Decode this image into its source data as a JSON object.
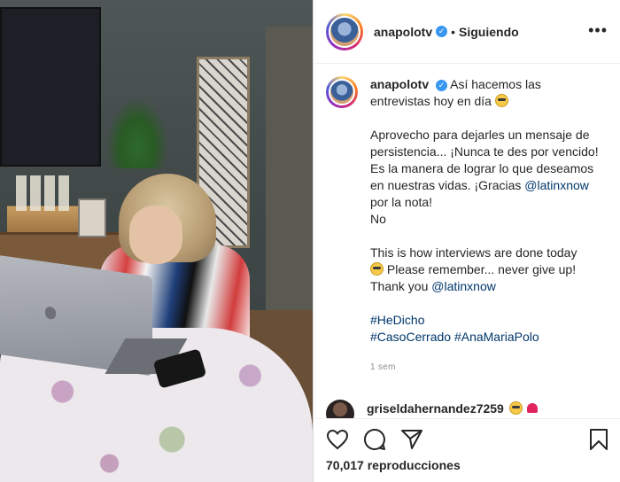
{
  "post": {
    "username": "anapolotv",
    "follow_status": "Siguiendo",
    "more_label": "•••"
  },
  "caption": {
    "username": "anapolotv",
    "line1": "Así hacemos las entrevistas hoy en día",
    "para2_pre": "Aprovecho para dejarles un mensaje de persistencia... ¡Nunca te des por vencido! Es la manera de lograr lo que deseamos en nuestras vidas. ¡Gracias",
    "mention1": "@latinxnow",
    "para2_post": "por la nota!",
    "line_no": "No",
    "para3_pre": "This is how interviews are done today",
    "para3_mid": "Please remember... never give up!",
    "para3_thanks": "Thank you",
    "mention2": "@latinxnow",
    "hashtag1": "#HeDicho",
    "hashtag2": "#CasoCerrado",
    "hashtag3": "#AnaMariaPolo",
    "time_ago": "1 sem"
  },
  "comment": {
    "username": "griseldahernandez7259"
  },
  "stats": {
    "views": "70,017 reproducciones"
  },
  "icons": [
    "heart-icon",
    "comment-icon",
    "share-icon",
    "bookmark-icon",
    "verified-icon"
  ]
}
